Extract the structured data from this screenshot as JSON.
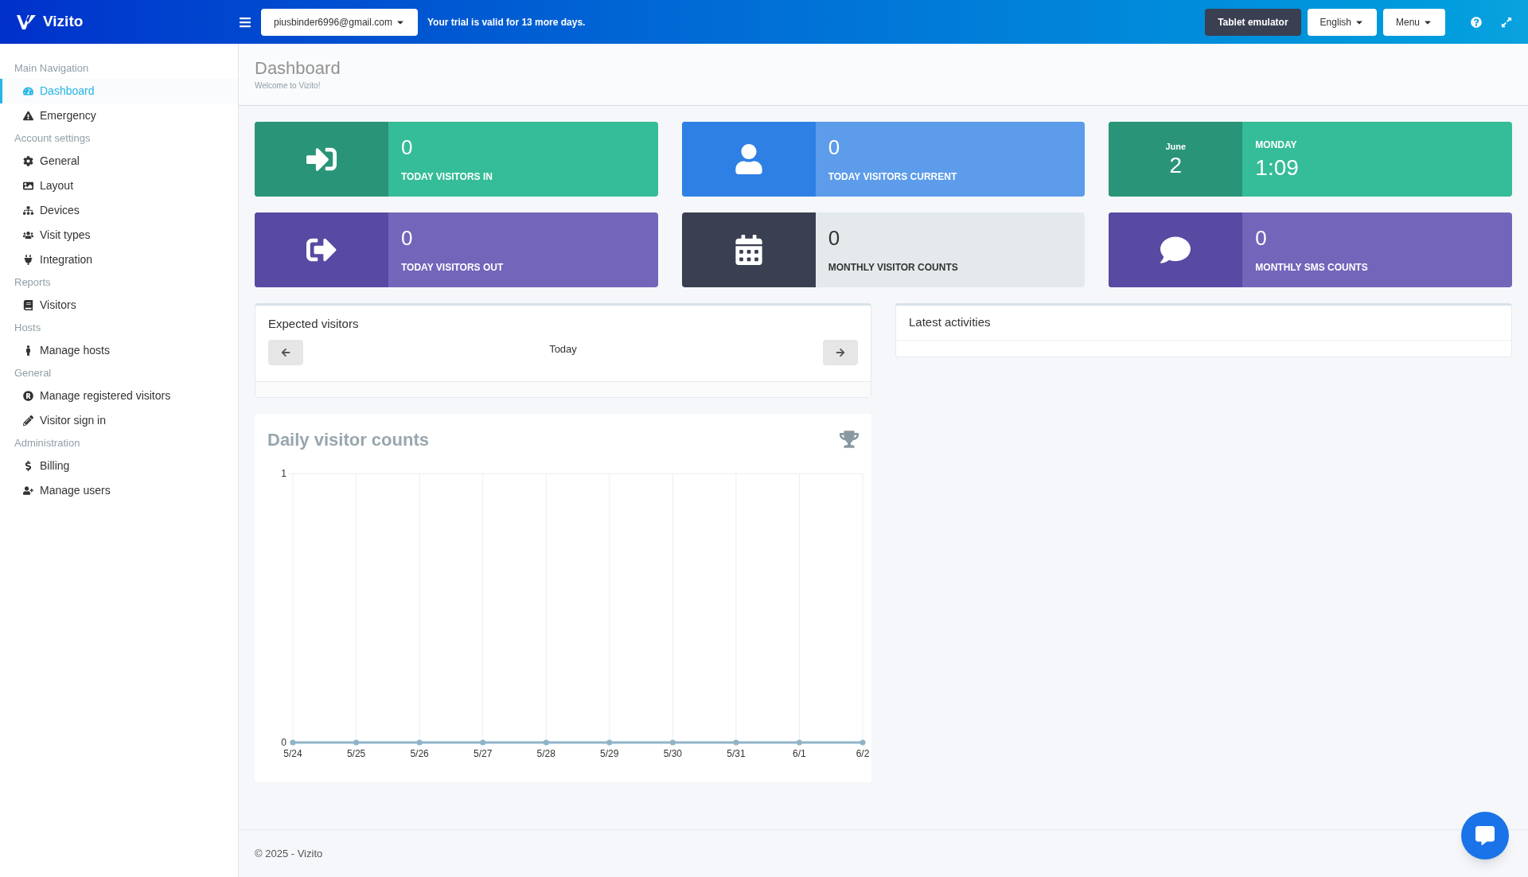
{
  "header": {
    "logo": "Vizito",
    "account": "piusbinder6996@gmail.com",
    "trial_notice": "Your trial is valid for 13 more days.",
    "tablet_button": "Tablet emulator",
    "language": "English",
    "menu": "Menu"
  },
  "sidebar": {
    "sections": [
      {
        "title": "Main Navigation",
        "items": [
          {
            "label": "Dashboard",
            "selected": true
          },
          {
            "label": "Emergency",
            "selected": false
          }
        ]
      },
      {
        "title": "Account settings",
        "items": [
          {
            "label": "General",
            "selected": false
          },
          {
            "label": "Layout",
            "selected": false
          },
          {
            "label": "Devices",
            "selected": false
          },
          {
            "label": "Visit types",
            "selected": false
          },
          {
            "label": "Integration",
            "selected": false
          }
        ]
      },
      {
        "title": "Reports",
        "items": [
          {
            "label": "Visitors",
            "selected": false
          }
        ]
      },
      {
        "title": "Hosts",
        "items": [
          {
            "label": "Manage hosts",
            "selected": false
          }
        ]
      },
      {
        "title": "General",
        "items": [
          {
            "label": "Manage registered visitors",
            "selected": false
          },
          {
            "label": "Visitor sign in",
            "selected": false
          }
        ]
      },
      {
        "title": "Administration",
        "items": [
          {
            "label": "Billing",
            "selected": false
          },
          {
            "label": "Manage users",
            "selected": false
          }
        ]
      }
    ]
  },
  "page": {
    "title": "Dashboard",
    "subtitle": "Welcome to Vizito!"
  },
  "tiles": [
    {
      "kind": "stat",
      "color": "#2a9478",
      "value": "0",
      "label": "TODAY VISITORS IN"
    },
    {
      "kind": "stat",
      "color": "#2f80e4",
      "value": "0",
      "label": "TODAY VISITORS CURRENT"
    },
    {
      "kind": "date",
      "color": "#2a9478",
      "month": "June",
      "day": "2",
      "weekday": "MONDAY",
      "time": "1:09"
    },
    {
      "kind": "stat",
      "color": "#5849a3",
      "value": "0",
      "label": "TODAY VISITORS OUT"
    },
    {
      "kind": "light_stat",
      "color": "#3a3f51",
      "value": "0",
      "label": "MONTHLY VISITOR COUNTS"
    },
    {
      "kind": "stat",
      "color": "#5849a3",
      "value": "0",
      "label": "MONTHLY SMS COUNTS"
    }
  ],
  "expected_visitors": {
    "title": "Expected visitors",
    "day": "Today"
  },
  "latest_activities": {
    "title": "Latest activities"
  },
  "daily_chart": {
    "title": "Daily visitor counts",
    "chart_data": {
      "type": "line",
      "categories": [
        "5/24",
        "5/25",
        "5/26",
        "5/27",
        "5/28",
        "5/29",
        "5/30",
        "5/31",
        "6/1",
        "6/2"
      ],
      "series": [
        {
          "color": "#8fb4c9",
          "marker": true,
          "values": [
            0,
            0,
            0,
            0,
            0,
            0,
            0,
            0,
            0,
            0
          ]
        }
      ],
      "ylim": [
        0,
        1
      ],
      "yticks": [
        0,
        1
      ],
      "grid": true
    }
  },
  "footer": "© 2025 - Vizito"
}
